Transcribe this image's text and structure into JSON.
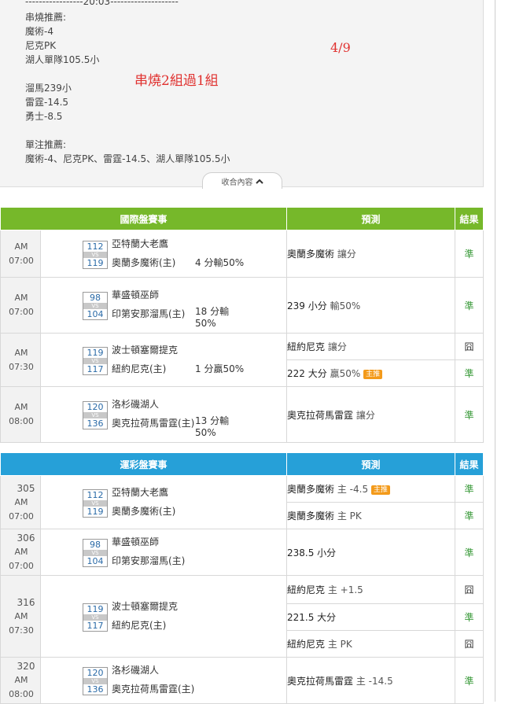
{
  "article": {
    "divider": "-----------------20:03--------------------",
    "parlay_title": "串燒推薦:",
    "parlay_group1": [
      "魔術-4",
      "尼克PK",
      "湖人單隊105.5小"
    ],
    "parlay_group2": [
      "溜馬239小",
      "雷霆-14.5",
      "勇士-8.5"
    ],
    "single_title": "單注推薦:",
    "single_picks": "魔術-4、尼克PK、雷霆-14.5、湖人單隊105.5小",
    "note_date": "4/9",
    "note_parlay": "串燒2組過1組",
    "collapse_label": "收合內容"
  },
  "intl_table": {
    "headers": [
      "國際盤賽事",
      "預測",
      "結果"
    ],
    "games": [
      {
        "time": "AM 07:00",
        "score_away": "112",
        "score_home": "119",
        "vs": "VS",
        "away": "亞特蘭大老鷹",
        "home": "奧蘭多魔術(主)",
        "line1": "",
        "line2": "4 分輸50%",
        "picks": [
          {
            "team": "奧蘭多魔術",
            "note": "讓分",
            "badge": "",
            "result": "準",
            "result_type": "win"
          }
        ]
      },
      {
        "time": "AM 07:00",
        "score_away": "98",
        "score_home": "104",
        "vs": "VS",
        "away": "華盛頓巫師",
        "home": "印第安那溜馬(主)",
        "line1": "18 分輸",
        "line2": "50%",
        "picks": [
          {
            "team": "239 小分",
            "note": "輸50%",
            "badge": "",
            "result": "準",
            "result_type": "win"
          }
        ]
      },
      {
        "time": "AM 07:30",
        "score_away": "119",
        "score_home": "117",
        "vs": "VS",
        "away": "波士頓塞爾提克",
        "home": "紐約尼克(主)",
        "line1": "",
        "line2": "1 分贏50%",
        "picks": [
          {
            "team": "紐約尼克",
            "note": "讓分",
            "badge": "",
            "result": "囧",
            "result_type": "lose"
          },
          {
            "team": "222 大分",
            "note": "贏50%",
            "badge": "主推",
            "result": "準",
            "result_type": "win"
          }
        ]
      },
      {
        "time": "AM 08:00",
        "score_away": "120",
        "score_home": "136",
        "vs": "VS",
        "away": "洛杉磯湖人",
        "home": "奧克拉荷馬雷霆(主)",
        "line1": "13 分輸",
        "line2": "50%",
        "picks": [
          {
            "team": "奧克拉荷馬雷霆",
            "note": "讓分",
            "badge": "",
            "result": "準",
            "result_type": "win"
          }
        ]
      }
    ]
  },
  "lottery_table": {
    "headers": [
      "運彩盤賽事",
      "預測",
      "結果"
    ],
    "games": [
      {
        "code": "305",
        "time": "AM 07:00",
        "score_away": "112",
        "score_home": "119",
        "vs": "VS",
        "away": "亞特蘭大老鷹",
        "home": "奧蘭多魔術(主)",
        "picks": [
          {
            "team": "奧蘭多魔術",
            "note": "主 -4.5",
            "badge": "主推",
            "result": "準",
            "result_type": "win"
          },
          {
            "team": "奧蘭多魔術",
            "note": "主 PK",
            "badge": "",
            "result": "準",
            "result_type": "win"
          }
        ]
      },
      {
        "code": "306",
        "time": "AM 07:00",
        "score_away": "98",
        "score_home": "104",
        "vs": "VS",
        "away": "華盛頓巫師",
        "home": "印第安那溜馬(主)",
        "picks": [
          {
            "team": "238.5 小分",
            "note": "",
            "badge": "",
            "result": "準",
            "result_type": "win"
          }
        ]
      },
      {
        "code": "316",
        "time": "AM 07:30",
        "score_away": "119",
        "score_home": "117",
        "vs": "VS",
        "away": "波士頓塞爾提克",
        "home": "紐約尼克(主)",
        "picks": [
          {
            "team": "紐約尼克",
            "note": "主 +1.5",
            "badge": "",
            "result": "囧",
            "result_type": "lose"
          },
          {
            "team": "221.5 大分",
            "note": "",
            "badge": "",
            "result": "準",
            "result_type": "win"
          },
          {
            "team": "紐約尼克",
            "note": "主 PK",
            "badge": "",
            "result": "囧",
            "result_type": "lose"
          }
        ]
      },
      {
        "code": "320",
        "time": "AM 08:00",
        "score_away": "120",
        "score_home": "136",
        "vs": "VS",
        "away": "洛杉磯湖人",
        "home": "奧克拉荷馬雷霆(主)",
        "picks": [
          {
            "team": "奧克拉荷馬雷霆",
            "note": "主 -14.5",
            "badge": "",
            "result": "準",
            "result_type": "win"
          }
        ]
      }
    ]
  }
}
